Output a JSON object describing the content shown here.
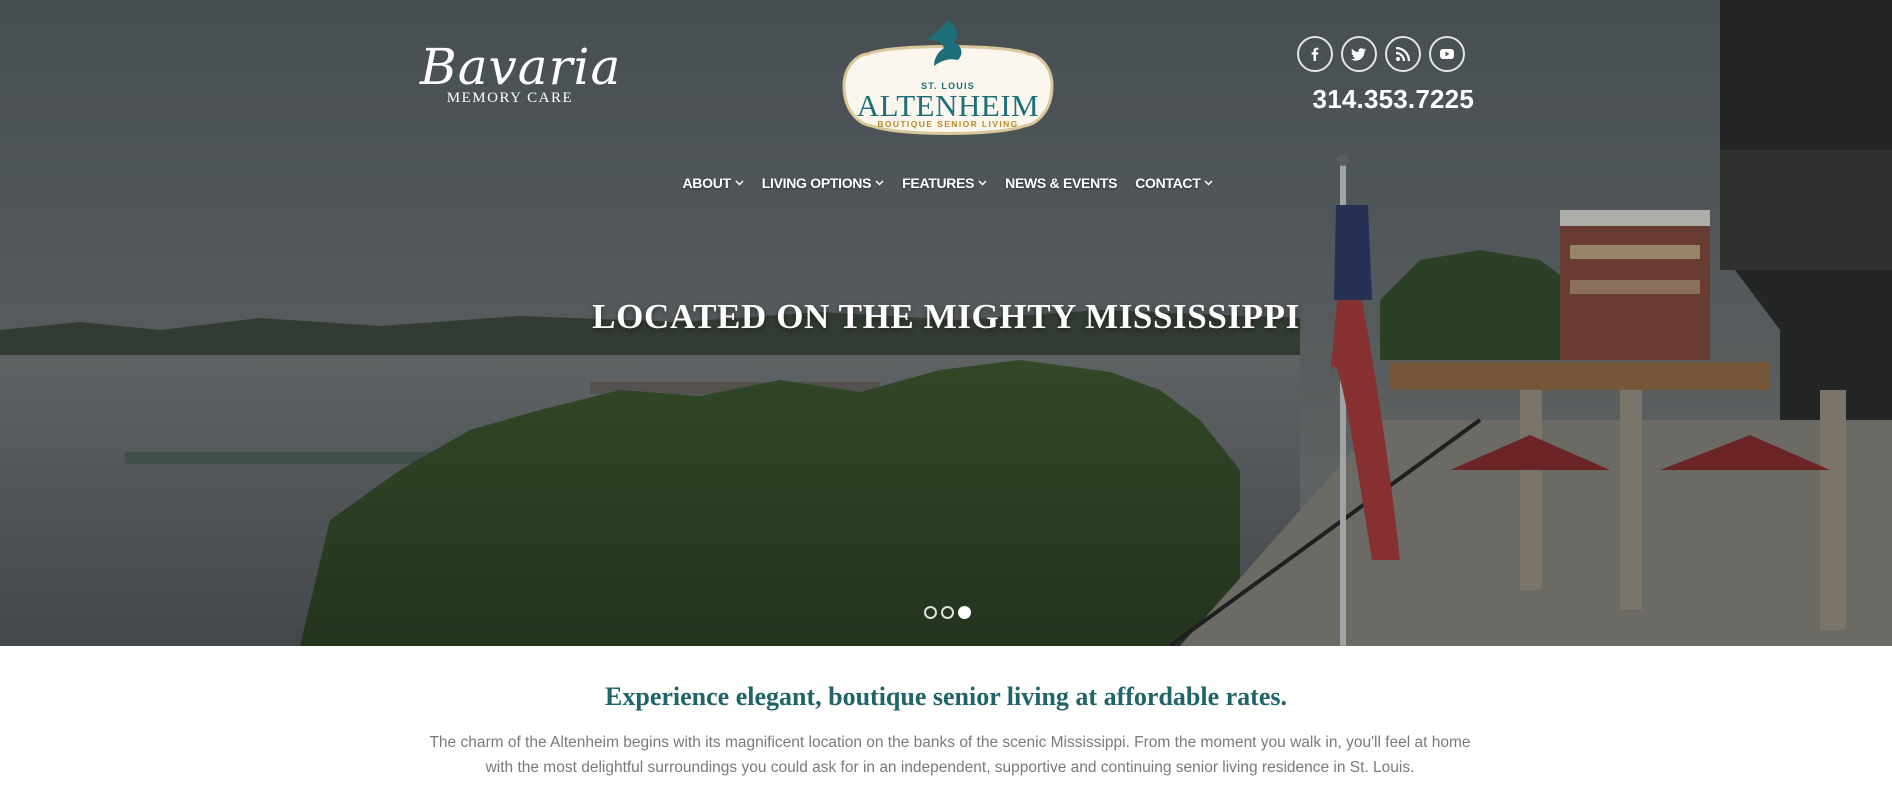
{
  "header": {
    "bavaria_logo": {
      "script": "Bavaria",
      "sub": "MEMORY CARE"
    },
    "altenheim_logo": {
      "top_line": "ST. LOUIS",
      "name": "ALTENHEIM",
      "tagline": "BOUTIQUE SENIOR LIVING"
    },
    "social": [
      {
        "name": "facebook",
        "icon": "facebook-icon"
      },
      {
        "name": "twitter",
        "icon": "twitter-icon"
      },
      {
        "name": "rss",
        "icon": "rss-icon"
      },
      {
        "name": "youtube",
        "icon": "youtube-icon"
      }
    ],
    "phone": "314.353.7225"
  },
  "nav": {
    "items": [
      {
        "label": "ABOUT",
        "has_dropdown": true
      },
      {
        "label": "LIVING OPTIONS",
        "has_dropdown": true
      },
      {
        "label": "FEATURES",
        "has_dropdown": true
      },
      {
        "label": "NEWS & EVENTS",
        "has_dropdown": false
      },
      {
        "label": "CONTACT",
        "has_dropdown": true
      }
    ]
  },
  "hero": {
    "caption": "LOCATED ON THE MIGHTY MISSISSIPPI",
    "slides_total": 3,
    "active_slide": 3
  },
  "intro": {
    "heading": "Experience elegant, boutique senior living at affordable rates.",
    "body": "The charm of the Altenheim begins with its magnificent location on the banks of the scenic Mississippi. From the moment you walk in, you'll feel at home with the most delightful surroundings you could ask for in an independent, supportive and continuing senior living residence in St. Louis."
  },
  "colors": {
    "brand_teal": "#1e6469",
    "logo_gold": "#b8892a",
    "body_text": "#7a7a7a"
  }
}
